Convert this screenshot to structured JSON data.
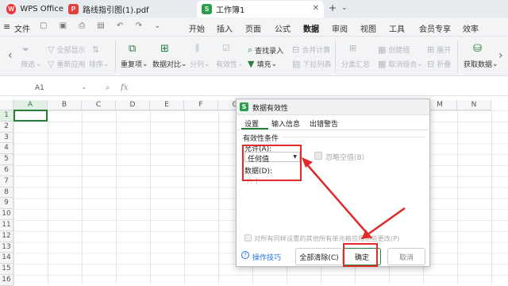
{
  "tabs": [
    {
      "label": "WPS Office",
      "icon": "wps-logo-icon"
    },
    {
      "label": "路线指引图(1).pdf",
      "icon": "pdf-icon"
    },
    {
      "label": "工作簿1",
      "icon": "spreadsheet-icon"
    }
  ],
  "menu": {
    "file": "文件",
    "items": [
      "开始",
      "插入",
      "页面",
      "公式",
      "数据",
      "审阅",
      "视图",
      "工具",
      "会员专享",
      "效率"
    ],
    "active": "数据"
  },
  "ribbon": {
    "filter": "筛选",
    "show_all": "全部显示",
    "reapply": "重新应用",
    "sort": "排序",
    "dup": "重复项",
    "compare": "数据对比",
    "split": "分列",
    "validity": "有效性",
    "find_entry": "查找录入",
    "fill": "填充",
    "consolidate": "合并计算",
    "dropdown": "下拉列表",
    "subtotal": "分类汇总",
    "group": "创建组",
    "ungroup": "取消组合",
    "expand": "展开",
    "collapse": "折叠",
    "get_data": "获取数据"
  },
  "formula_bar": {
    "cell_ref": "A1",
    "fx": "fx"
  },
  "columns": [
    "A",
    "B",
    "C",
    "D",
    "E",
    "F",
    "G",
    "H",
    "I",
    "J",
    "K",
    "L",
    "M",
    "N"
  ],
  "rows": [
    "1",
    "2",
    "3",
    "4",
    "5",
    "6",
    "7",
    "8",
    "9",
    "10",
    "11",
    "12",
    "13",
    "14",
    "15",
    "16"
  ],
  "dialog": {
    "title": "数据有效性",
    "tabs": [
      "设置",
      "输入信息",
      "出错警告"
    ],
    "section": "有效性条件",
    "allow_label": "允许(A):",
    "allow_value": "任何值",
    "ignore_blank": "忽略空值(B)",
    "data_label": "数据(D):",
    "data_value": "介于",
    "apply_all": "对所有同样设置的其他所有单元格应用这些更改(P)",
    "tips": "操作技巧",
    "clear_all": "全部清除(C)",
    "ok": "确定",
    "cancel": "取消"
  },
  "colors": {
    "accent": "#2a7d3a",
    "annotation": "#e02b2b",
    "link": "#1a73e8"
  }
}
